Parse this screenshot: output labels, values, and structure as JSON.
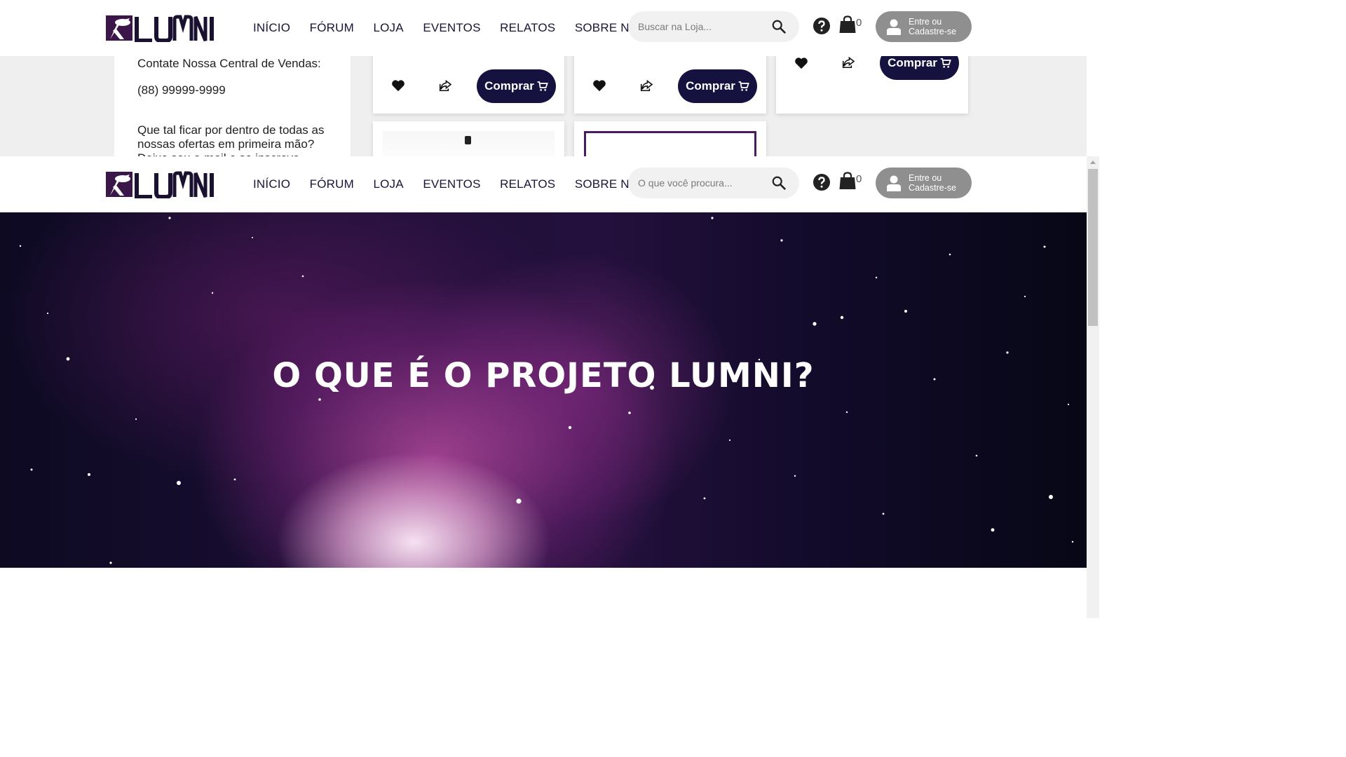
{
  "brand": {
    "name": "LUMNI",
    "primary_color": "#15123f",
    "accent_color": "#5b2b6e"
  },
  "nav": [
    "INÍCIO",
    "FÓRUM",
    "LOJA",
    "EVENTOS",
    "RELATOS",
    "SOBRE NÓS"
  ],
  "header_top": {
    "search_placeholder": "Buscar na Loja...",
    "cart_count": "0",
    "login_label": "Entre ou Cadastre-se"
  },
  "header_main": {
    "search_placeholder": "O que você procura...",
    "cart_count": "0",
    "login_label": "Entre ou Cadastre-se"
  },
  "sidebar": {
    "contact_label": "Contate Nossa Central de Vendas:",
    "phone": "(88) 99999-9999",
    "newsletter_line1": "Que tal ficar por dentro de todas as",
    "newsletter_line2": "nossas ofertas em primeira mão?",
    "newsletter_line3": "Deixe seu e-mail e se inscreva."
  },
  "products": [
    {
      "buy_label": "Comprar"
    },
    {
      "buy_label": "Comprar"
    },
    {
      "buy_label": "Comprar"
    }
  ],
  "hero": {
    "title": "O QUE É O PROJETO LUMNI?"
  },
  "icons": [
    "search-icon",
    "help-icon",
    "cart-icon",
    "user-icon",
    "heart-icon",
    "share-icon"
  ]
}
